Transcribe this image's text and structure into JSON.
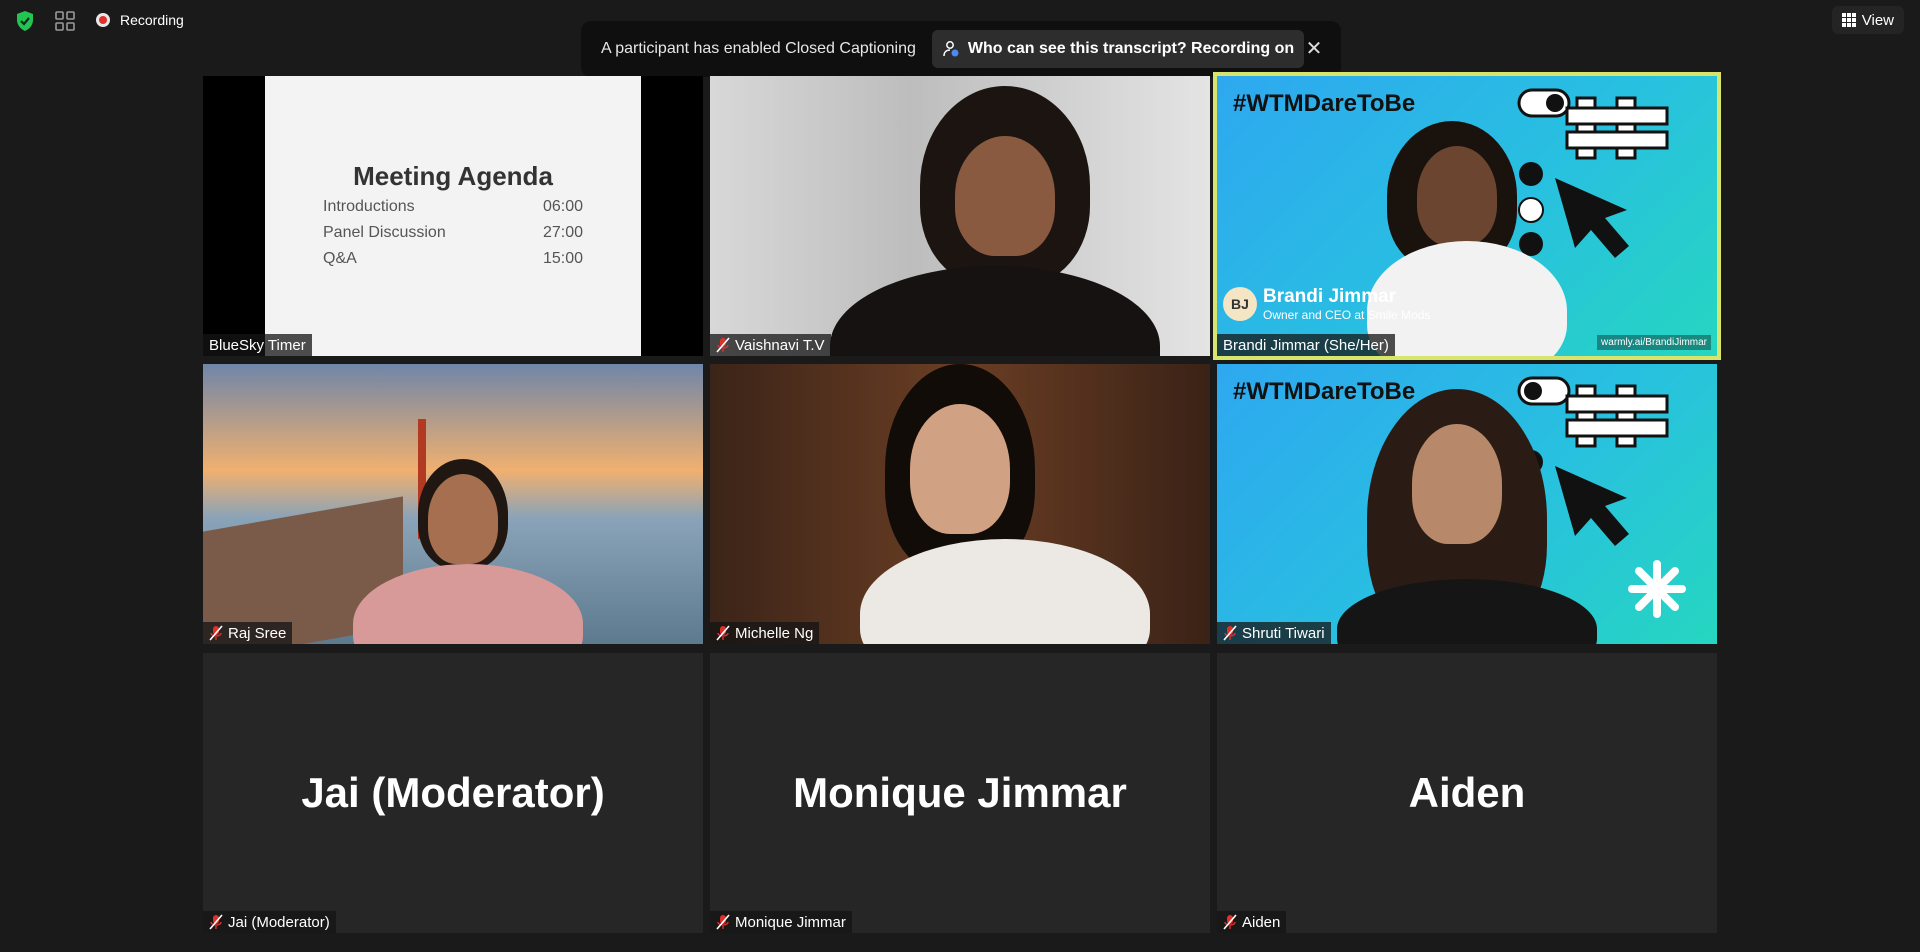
{
  "topbar": {
    "recording_label": "Recording",
    "view_label": "View"
  },
  "banner": {
    "message": "A participant has enabled Closed Captioning",
    "pill_text": "Who can see this transcript? Recording on",
    "close_glyph": "✕"
  },
  "tiles": {
    "t1": {
      "name": "BlueSky Timer"
    },
    "t2": {
      "name": "Vaishnavi T.V"
    },
    "t3": {
      "name": "Brandi Jimmar (She/Her)"
    },
    "t4": {
      "name": "Raj Sree"
    },
    "t5": {
      "name": "Michelle Ng"
    },
    "t6": {
      "name": "Shruti Tiwari"
    },
    "t7": {
      "name": "Jai (Moderator)",
      "big_name": "Jai (Moderator)"
    },
    "t8": {
      "name": "Monique Jimmar",
      "big_name": "Monique Jimmar"
    },
    "t9": {
      "name": "Aiden",
      "big_name": "Aiden"
    }
  },
  "agenda": {
    "title": "Meeting Agenda",
    "items": [
      {
        "label": "Introductions",
        "time": "06:00"
      },
      {
        "label": "Panel Discussion",
        "time": "27:00"
      },
      {
        "label": "Q&A",
        "time": "15:00"
      }
    ]
  },
  "wtm": {
    "hashtag": "#WTMDareToBe",
    "lower3_initials": "BJ",
    "lower3_name": "Brandi Jimmar",
    "lower3_title": "Owner and CEO at Smile Mods",
    "link": "warmly.ai/BrandiJimmar"
  },
  "colors": {
    "active_speaker": "#d8e56c",
    "secure_green": "#23c552",
    "muted_red": "#e0302c"
  },
  "icons": [
    "shield-check-icon",
    "grid-icon",
    "recording-icon",
    "view-grid-icon",
    "person-caption-icon",
    "close-icon",
    "mic-off-icon"
  ]
}
